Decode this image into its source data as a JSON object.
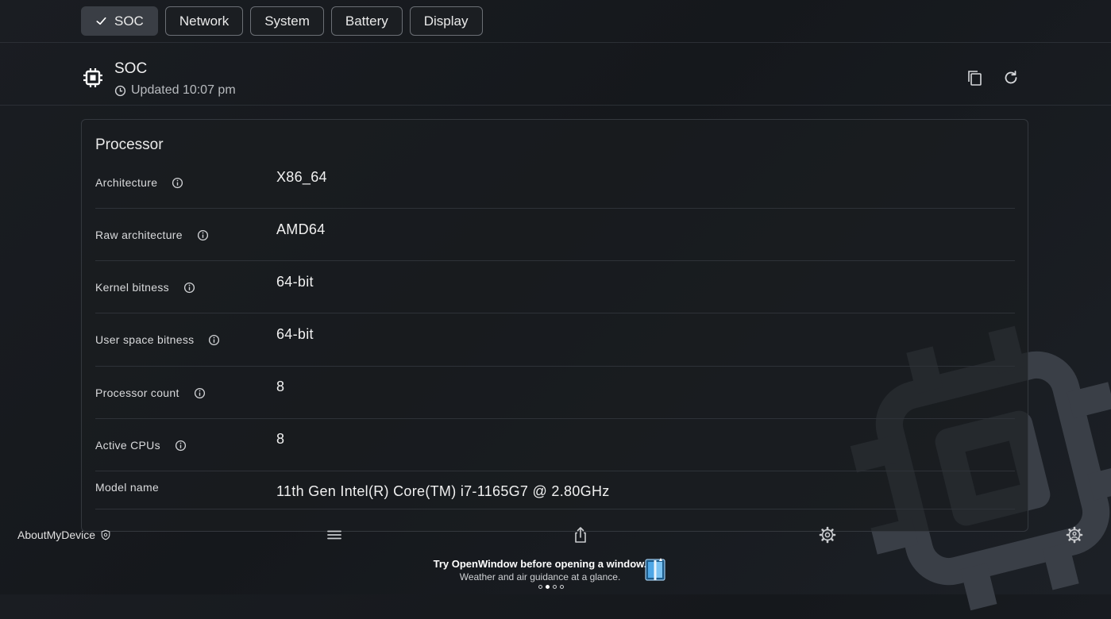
{
  "tabs": [
    {
      "label": "SOC",
      "active": true
    },
    {
      "label": "Network",
      "active": false
    },
    {
      "label": "System",
      "active": false
    },
    {
      "label": "Battery",
      "active": false
    },
    {
      "label": "Display",
      "active": false
    }
  ],
  "header": {
    "icon": "chip-icon",
    "title": "SOC",
    "updated": "Updated 10:07 pm",
    "actions": [
      "copy-icon",
      "refresh-icon"
    ]
  },
  "processor": {
    "title": "Processor",
    "rows": [
      {
        "label": "Architecture",
        "value": "X86_64",
        "info": true
      },
      {
        "label": "Raw architecture",
        "value": "AMD64",
        "info": true
      },
      {
        "label": "Kernel bitness",
        "value": "64-bit",
        "info": true
      },
      {
        "label": "User space bitness",
        "value": "64-bit",
        "info": true
      },
      {
        "label": "Processor count",
        "value": "8",
        "info": true
      },
      {
        "label": "Active CPUs",
        "value": "8",
        "info": true
      },
      {
        "label": "Model name",
        "value": "11th Gen Intel(R) Core(TM) i7-1165G7 @ 2.80GHz",
        "info": false
      }
    ]
  },
  "bottom_bar": {
    "brand": "AboutMyDevice",
    "brand_icon": "shield-icon",
    "icons": [
      "menu-icon",
      "share-icon",
      "settings-icon",
      "settings-alt-icon"
    ]
  },
  "ad": {
    "title": "Try OpenWindow before opening a window.",
    "subtitle": "Weather and air guidance at a glance.",
    "dots": 4,
    "active_dot": 1
  },
  "colors": {
    "background": "#17191d",
    "tab_active": "#3a3e45",
    "tab_border": "#6b6f75",
    "text_primary": "#f0f0f0",
    "text_secondary": "#b8bbbf"
  }
}
